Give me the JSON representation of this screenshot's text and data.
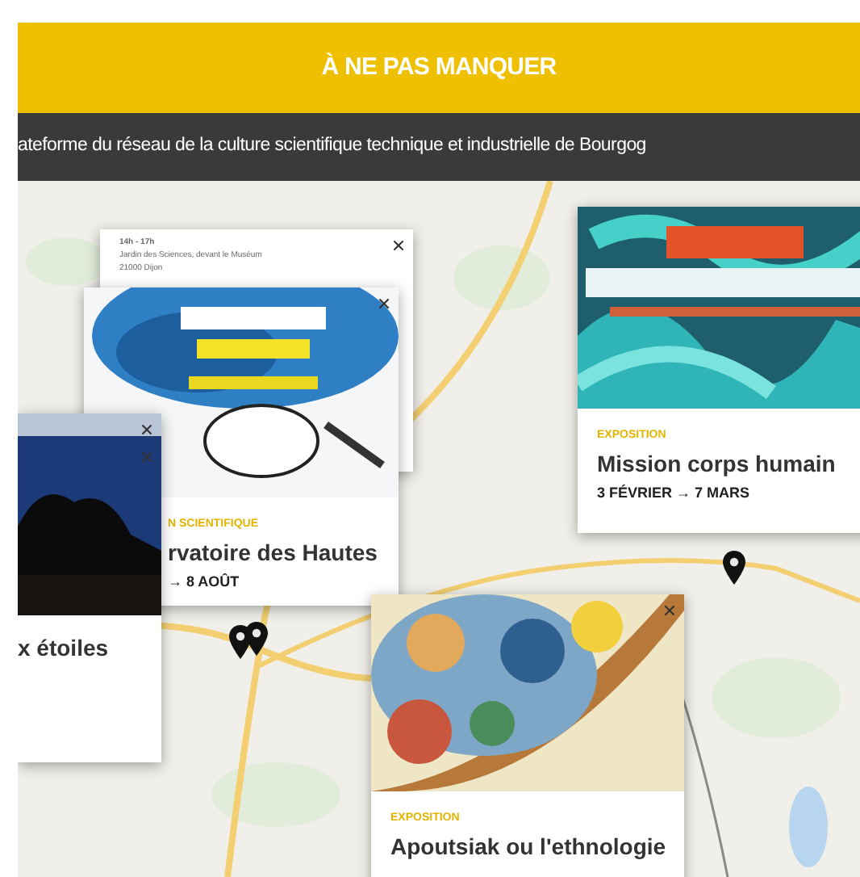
{
  "header": {
    "title": "À NE PAS MANQUER"
  },
  "tagline": "ateforme du réseau de la culture scientifique technique et industrielle de Bourgog",
  "popups": [
    {
      "kind": "info",
      "details": [
        "14h - 17h",
        "Jardin des Sciences, devant le Muséum",
        "21000 Dijon"
      ]
    },
    {
      "kind": "event",
      "category": "N SCIENTIFIQUE",
      "title": "rvatoire des Hautes",
      "date": "→ 8 AOÛT"
    },
    {
      "kind": "event",
      "title": "x étoiles"
    },
    {
      "kind": "event",
      "category": "EXPOSITION",
      "title": "Mission corps humain",
      "date": "3 FÉVRIER → 7 MARS"
    },
    {
      "kind": "event",
      "category": "EXPOSITION",
      "title": "Apoutsiak ou l'ethnologie"
    }
  ]
}
